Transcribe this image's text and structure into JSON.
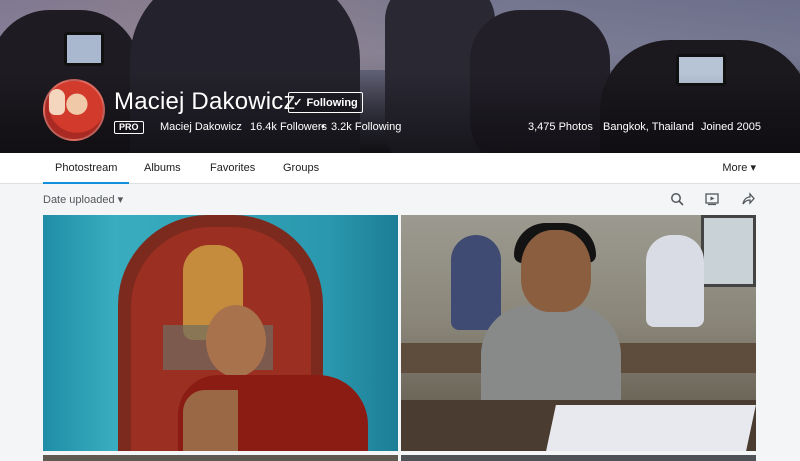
{
  "profile": {
    "display_name": "Maciej Dakowicz",
    "follow_button_label": "Following",
    "badge": "PRO",
    "username": "Maciej Dakowicz",
    "followers": "16.4k Followers",
    "separator": "•",
    "following": "3.2k Following",
    "photos": "3,475 Photos",
    "location": "Bangkok, Thailand",
    "joined": "Joined 2005"
  },
  "nav": {
    "tabs": [
      {
        "label": "Photostream",
        "active": true
      },
      {
        "label": "Albums",
        "active": false
      },
      {
        "label": "Favorites",
        "active": false
      },
      {
        "label": "Groups",
        "active": false
      }
    ],
    "more_label": "More ▾"
  },
  "toolbar": {
    "sort_label": "Date uploaded ▾",
    "icons": [
      "search-icon",
      "slideshow-icon",
      "share-icon"
    ]
  },
  "colors": {
    "accent": "#128fdc",
    "nav_bg": "#ffffff",
    "page_bg": "#f3f5f6",
    "text_dark": "#212124"
  }
}
